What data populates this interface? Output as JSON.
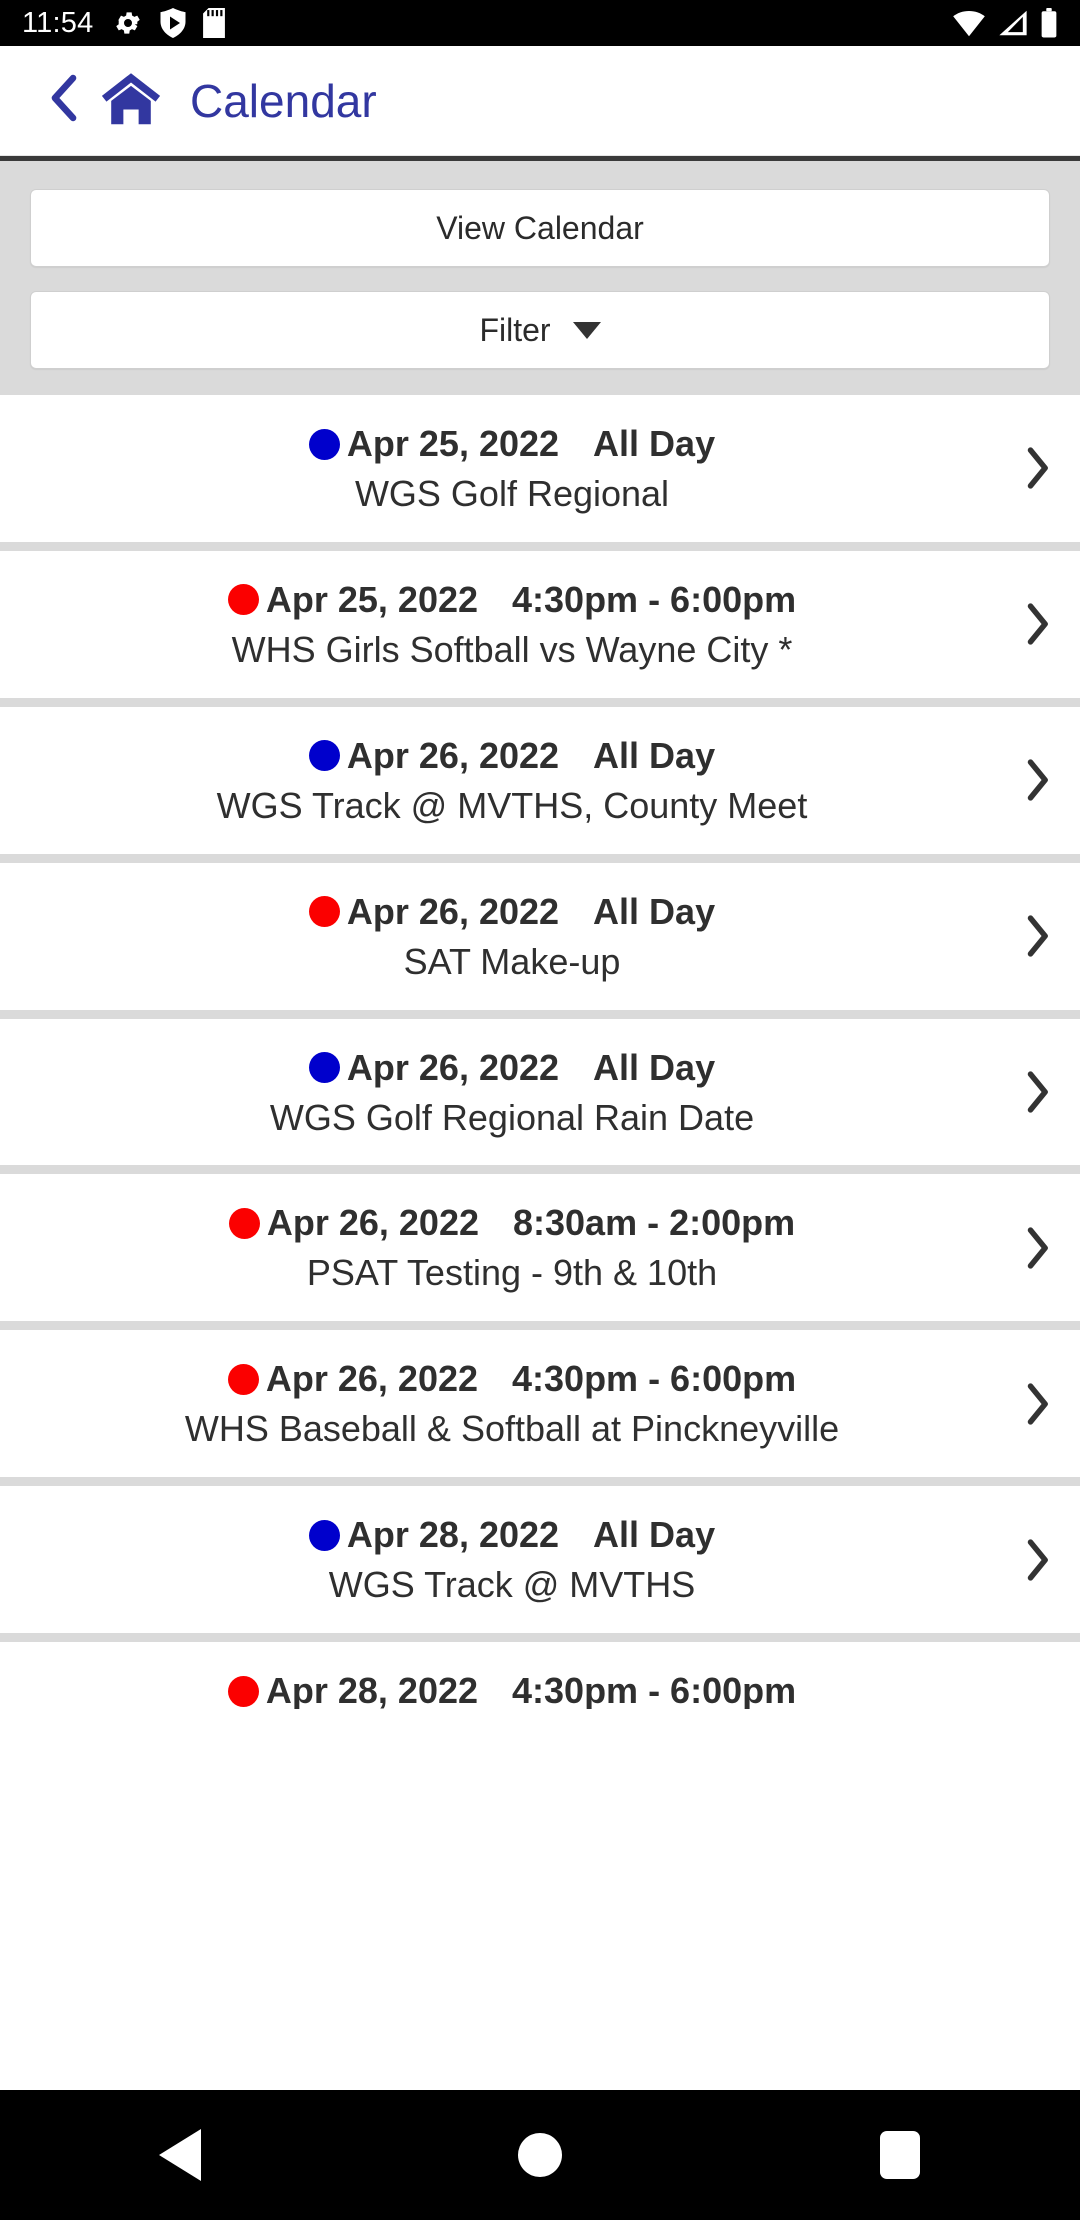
{
  "status_bar": {
    "time": "11:54",
    "left_icons": [
      "gear-icon",
      "play-icon",
      "sd-card-icon"
    ],
    "right_icons": [
      "wifi-icon",
      "cell-signal-icon",
      "battery-icon"
    ]
  },
  "header": {
    "back_icon": "chevron-left-icon",
    "home_icon": "home-icon",
    "title": "Calendar",
    "accent_color": "#3237A0"
  },
  "toolbar": {
    "view_calendar_label": "View Calendar",
    "filter_label": "Filter",
    "filter_caret_icon": "caret-down-icon"
  },
  "colors": {
    "dot_blue": "#0000CC",
    "dot_red": "#FB0000",
    "panel_gray": "#DADADA",
    "text": "#2F2F2F"
  },
  "events": [
    {
      "dot_color": "blue",
      "date": "Apr 25, 2022",
      "time": "All Day",
      "title": "WGS Golf Regional",
      "chevron_icon": "chevron-right-icon"
    },
    {
      "dot_color": "red",
      "date": "Apr 25, 2022",
      "time": "4:30pm - 6:00pm",
      "title": "WHS Girls Softball vs Wayne City *",
      "chevron_icon": "chevron-right-icon"
    },
    {
      "dot_color": "blue",
      "date": "Apr 26, 2022",
      "time": "All Day",
      "title": "WGS Track @ MVTHS, County Meet",
      "chevron_icon": "chevron-right-icon"
    },
    {
      "dot_color": "red",
      "date": "Apr 26, 2022",
      "time": "All Day",
      "title": "SAT Make-up",
      "chevron_icon": "chevron-right-icon"
    },
    {
      "dot_color": "blue",
      "date": "Apr 26, 2022",
      "time": "All Day",
      "title": "WGS Golf Regional Rain Date",
      "chevron_icon": "chevron-right-icon"
    },
    {
      "dot_color": "red",
      "date": "Apr 26, 2022",
      "time": "8:30am - 2:00pm",
      "title": "PSAT Testing - 9th & 10th",
      "chevron_icon": "chevron-right-icon"
    },
    {
      "dot_color": "red",
      "date": "Apr 26, 2022",
      "time": "4:30pm - 6:00pm",
      "title": "WHS Baseball & Softball at Pinckneyville",
      "chevron_icon": "chevron-right-icon"
    },
    {
      "dot_color": "blue",
      "date": "Apr 28, 2022",
      "time": "All Day",
      "title": "WGS Track @ MVTHS",
      "chevron_icon": "chevron-right-icon"
    },
    {
      "dot_color": "red",
      "date": "Apr 28, 2022",
      "time": "4:30pm - 6:00pm",
      "title": "",
      "chevron_icon": "chevron-right-icon"
    }
  ],
  "nav_bar": {
    "back_icon": "nav-back-triangle-icon",
    "home_icon": "nav-home-circle-icon",
    "recents_icon": "nav-recents-square-icon"
  }
}
